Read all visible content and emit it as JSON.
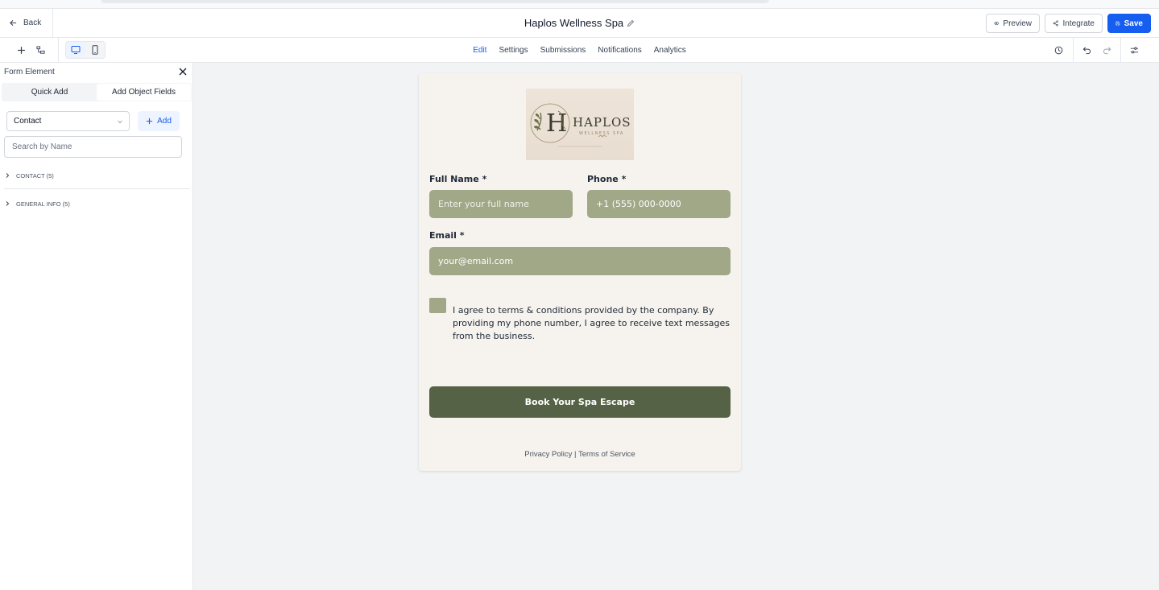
{
  "header": {
    "back_label": "Back",
    "form_title": "Haplos Wellness Spa",
    "preview_label": "Preview",
    "integrate_label": "Integrate",
    "save_label": "Save"
  },
  "toolbar": {
    "tabs": [
      {
        "label": "Edit",
        "active": true
      },
      {
        "label": "Settings",
        "active": false
      },
      {
        "label": "Submissions",
        "active": false
      },
      {
        "label": "Notifications",
        "active": false
      },
      {
        "label": "Analytics",
        "active": false
      }
    ]
  },
  "sidebar": {
    "title": "Form Element",
    "tabs": [
      "Quick Add",
      "Add Object Fields"
    ],
    "object_select": "Contact",
    "add_label": "Add",
    "search_placeholder": "Search by Name",
    "groups": [
      {
        "label": "CONTACT (5)"
      },
      {
        "label": "GENERAL INFO (5)"
      }
    ]
  },
  "form": {
    "logo_text": "HAPLOS",
    "logo_subtext": "WELLNESS SPA",
    "full_name_label": "Full Name",
    "full_name_placeholder": "Enter your full name",
    "phone_label": "Phone",
    "phone_value": "+1 (555) 000-0000",
    "email_label": "Email",
    "email_value": "your@email.com",
    "required_marker": "*",
    "consent_text": "I agree to terms & conditions provided by the company. By providing my phone number, I agree to receive text messages from the business.",
    "submit_label": "Book Your Spa Escape",
    "privacy_label": "Privacy Policy",
    "terms_label": "Terms of Service",
    "footer_separator": "|"
  },
  "colors": {
    "accent": "#155eef",
    "field_fill": "#a0a888",
    "button_fill": "#556245",
    "card_bg": "#f6f3ee"
  }
}
